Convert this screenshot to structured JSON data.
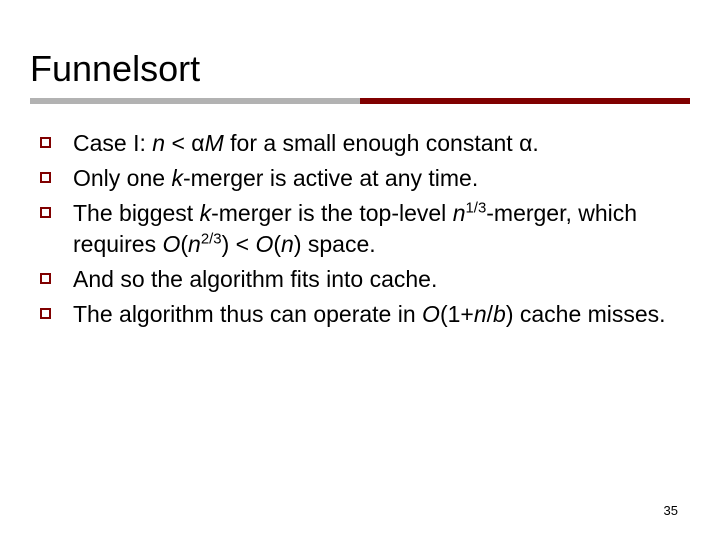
{
  "slide": {
    "title": "Funnelsort",
    "page_number": "35",
    "rule_colors": {
      "left": "#b2b2b2",
      "right": "#800000"
    },
    "bullets": [
      {
        "segments": [
          {
            "t": "Case I: ",
            "i": false
          },
          {
            "t": "n",
            "i": true
          },
          {
            "t": " < α",
            "i": false
          },
          {
            "t": "M",
            "i": true
          },
          {
            "t": " for a small enough constant α.",
            "i": false
          }
        ]
      },
      {
        "segments": [
          {
            "t": "Only one ",
            "i": false
          },
          {
            "t": "k",
            "i": true
          },
          {
            "t": "-merger is active at any time.",
            "i": false
          }
        ]
      },
      {
        "segments": [
          {
            "t": "The biggest ",
            "i": false
          },
          {
            "t": "k",
            "i": true
          },
          {
            "t": "-merger is the top-level ",
            "i": false
          },
          {
            "t": "n",
            "i": true
          },
          {
            "t": "1/3",
            "i": false,
            "sup": true
          },
          {
            "t": "-merger, which requires ",
            "i": false
          },
          {
            "t": "O",
            "i": true
          },
          {
            "t": "(",
            "i": false
          },
          {
            "t": "n",
            "i": true
          },
          {
            "t": "2/3",
            "i": false,
            "sup": true
          },
          {
            "t": ") < ",
            "i": false
          },
          {
            "t": "O",
            "i": true
          },
          {
            "t": "(",
            "i": false
          },
          {
            "t": "n",
            "i": true
          },
          {
            "t": ") space.",
            "i": false
          }
        ]
      },
      {
        "segments": [
          {
            "t": "And so the algorithm fits into cache.",
            "i": false
          }
        ]
      },
      {
        "segments": [
          {
            "t": "The algorithm thus can operate in ",
            "i": false
          },
          {
            "t": "O",
            "i": true
          },
          {
            "t": "(1+",
            "i": false
          },
          {
            "t": "n",
            "i": true
          },
          {
            "t": "/",
            "i": false
          },
          {
            "t": "b",
            "i": true
          },
          {
            "t": ") cache misses.",
            "i": false
          }
        ]
      }
    ]
  }
}
